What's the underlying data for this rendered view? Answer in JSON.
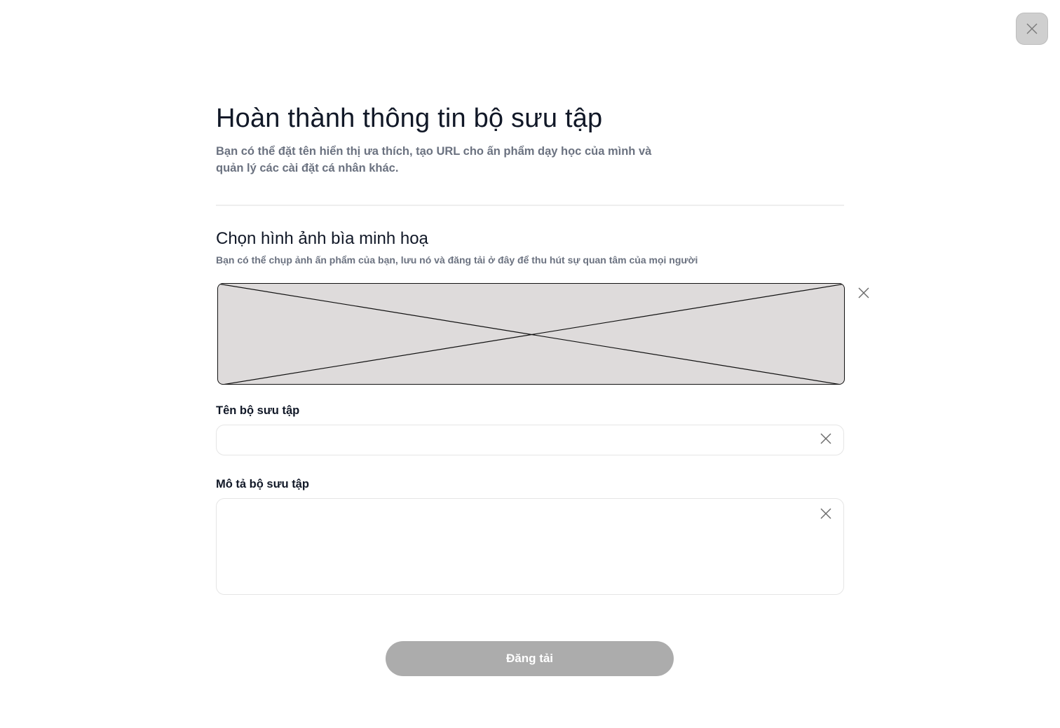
{
  "modal": {
    "close_icon": "close-icon"
  },
  "header": {
    "title": "Hoàn thành thông tin bộ sưu tập",
    "subtitle": "Bạn có thể đặt tên hiển thị ưa thích, tạo URL cho ấn phẩm dạy học của mình và quản lý các cài đặt cá nhân khác."
  },
  "cover": {
    "title": "Chọn hình ảnh bìa minh hoạ",
    "subtitle": "Bạn có thể chụp ảnh ấn phẩm của bạn, lưu nó và đăng tải ở đây để thu hút sự quan tâm của mọi người",
    "placeholder_icon": "image-placeholder-icon",
    "remove_icon": "close-icon"
  },
  "form": {
    "name_label": "Tên bộ sưu tập",
    "name_value": "",
    "name_placeholder": "",
    "description_label": "Mô tả bộ sưu tập",
    "description_value": "",
    "description_placeholder": ""
  },
  "actions": {
    "submit_label": "Đăng tải"
  },
  "colors": {
    "title_text": "#111827",
    "muted_text": "#6b7280",
    "image_placeholder_bg": "#dedbdb",
    "button_disabled_bg": "#acacac",
    "close_button_bg": "#cfcfcf"
  }
}
